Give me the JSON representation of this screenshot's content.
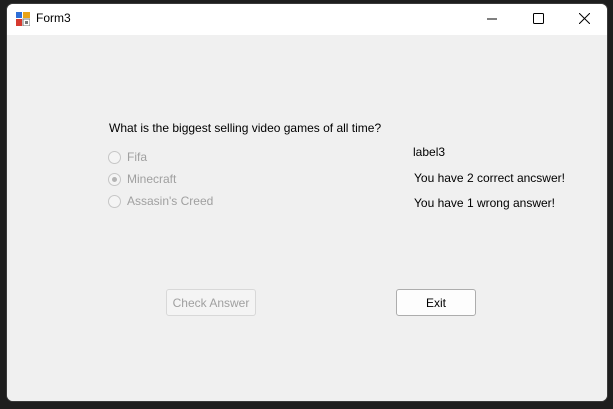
{
  "window": {
    "title": "Form3"
  },
  "quiz": {
    "question": "What is the biggest selling video games of all time?",
    "options": [
      {
        "label": "Fifa",
        "checked": false
      },
      {
        "label": "Minecraft",
        "checked": true
      },
      {
        "label": "Assasin's Creed",
        "checked": false
      }
    ],
    "label3": "label3",
    "correct_message": "You have 2 correct ancswer!",
    "wrong_message": "You have 1 wrong answer!"
  },
  "buttons": {
    "check_answer": "Check Answer",
    "exit": "Exit"
  },
  "icons": {
    "app": "form-app-icon",
    "minimize": "minimize-icon",
    "maximize": "maximize-icon",
    "close": "close-icon"
  }
}
